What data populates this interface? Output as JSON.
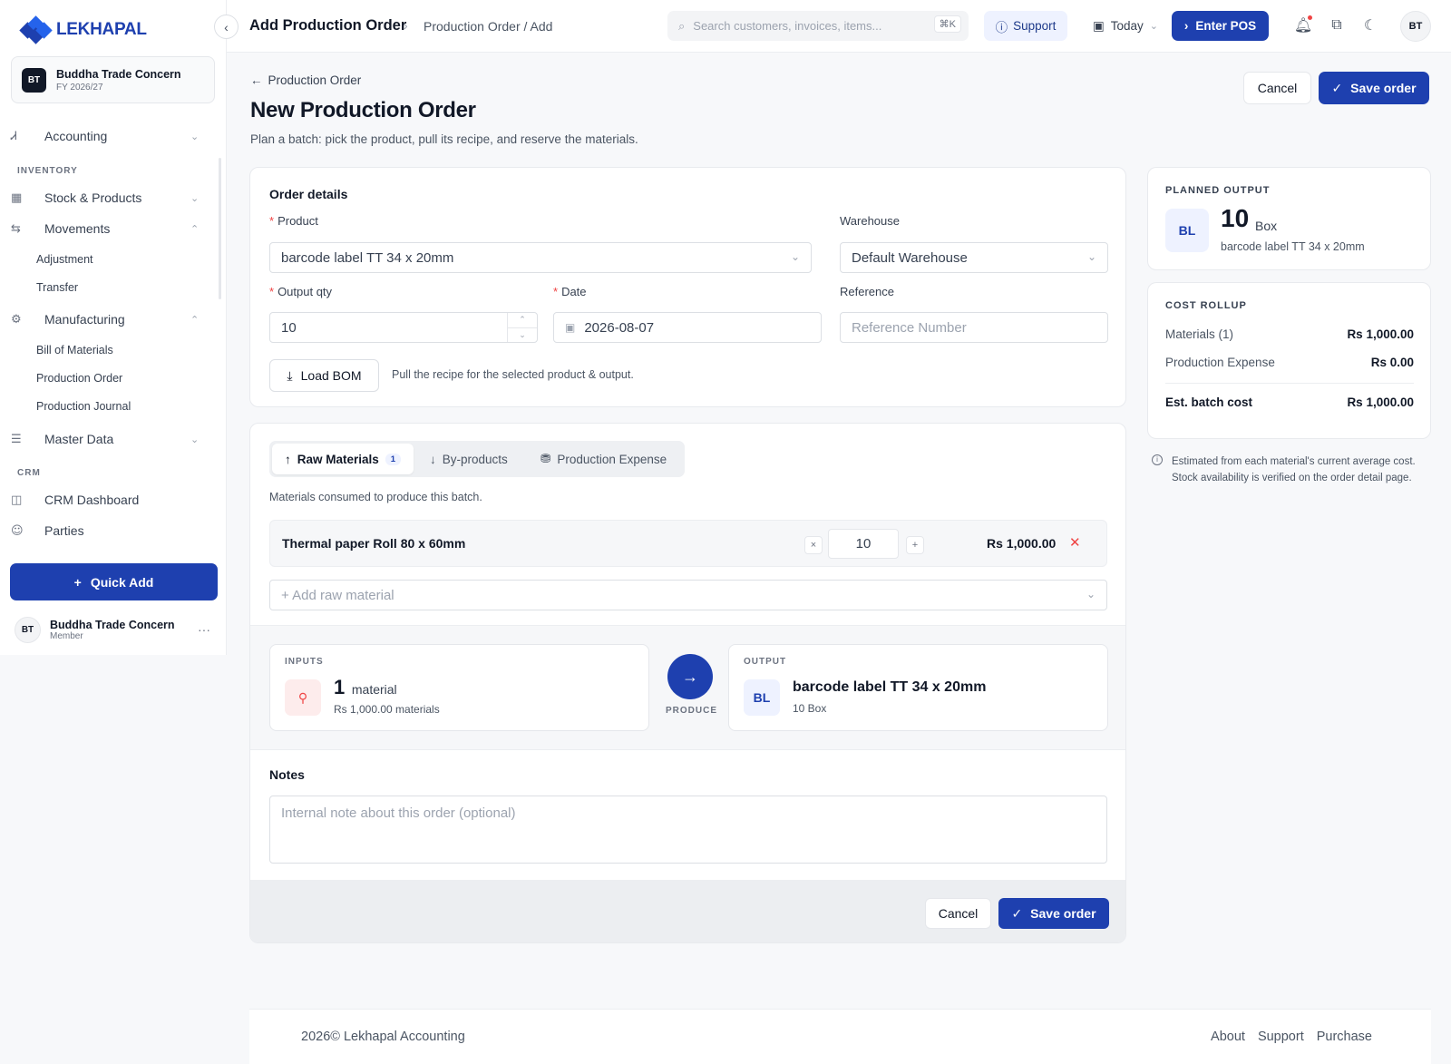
{
  "brand": {
    "name": "LEKHAPAL"
  },
  "org": {
    "initials": "BT",
    "name": "Buddha Trade Concern",
    "fy": "FY 2026/27"
  },
  "nav": {
    "accounting": "Accounting",
    "inventory_section": "INVENTORY",
    "stock": "Stock & Products",
    "movements": "Movements",
    "adjustment": "Adjustment",
    "transfer": "Transfer",
    "manufacturing": "Manufacturing",
    "bom": "Bill of Materials",
    "production_order": "Production Order",
    "production_journal": "Production Journal",
    "master_data": "Master Data",
    "crm_section": "CRM",
    "crm_dashboard": "CRM Dashboard",
    "parties": "Parties"
  },
  "quick_add": "Quick Add",
  "user": {
    "initials": "BT",
    "name": "Buddha Trade Concern",
    "role": "Member"
  },
  "topbar": {
    "title": "Add Production Order",
    "breadcrumb": "Production Order / Add",
    "search_placeholder": "Search customers, invoices, items...",
    "search_kbd": "⌘K",
    "support": "Support",
    "date": "Today",
    "pos": "Enter POS",
    "avatar": "BT"
  },
  "page": {
    "back": "Production Order",
    "title": "New Production Order",
    "subtitle": "Plan a batch: pick the product, pull its recipe, and reserve the materials.",
    "cancel": "Cancel",
    "save": "Save order"
  },
  "order_details": {
    "heading": "Order details",
    "product_label": "Product",
    "product_value": "barcode label TT 34 x 20mm",
    "warehouse_label": "Warehouse",
    "warehouse_value": "Default Warehouse",
    "qty_label": "Output qty",
    "qty_value": "10",
    "date_label": "Date",
    "date_value": "2026-08-07",
    "reference_label": "Reference",
    "reference_placeholder": "Reference Number",
    "load_bom": "Load BOM",
    "load_bom_hint": "Pull the recipe for the selected product & output."
  },
  "materials": {
    "tabs": [
      {
        "label": "Raw Materials",
        "badge": "1"
      },
      {
        "label": "By-products"
      },
      {
        "label": "Production Expense"
      }
    ],
    "description": "Materials consumed to produce this batch.",
    "rows": [
      {
        "name": "Thermal paper Roll 80 x 60mm",
        "qty": "10",
        "amount": "Rs 1,000.00"
      }
    ],
    "add_placeholder": "+ Add raw material"
  },
  "flow": {
    "inputs_label": "INPUTS",
    "inputs_count": "1",
    "inputs_unit": "material",
    "inputs_cost": "Rs 1,000.00 materials",
    "produce_label": "PRODUCE",
    "output_label": "OUTPUT",
    "output_initials": "BL",
    "output_name": "barcode label TT 34 x 20mm",
    "output_qty": "10 Box"
  },
  "notes": {
    "heading": "Notes",
    "placeholder": "Internal note about this order (optional)"
  },
  "planned_output": {
    "heading": "PLANNED OUTPUT",
    "initials": "BL",
    "qty": "10",
    "unit": "Box",
    "product": "barcode label TT 34 x 20mm"
  },
  "cost_rollup": {
    "heading": "COST ROLLUP",
    "materials_label": "Materials (1)",
    "materials_value": "Rs 1,000.00",
    "expense_label": "Production Expense",
    "expense_value": "Rs 0.00",
    "total_label": "Est. batch cost",
    "total_value": "Rs 1,000.00",
    "note": "Estimated from each material's current average cost. Stock availability is verified on the order detail page."
  },
  "footer": {
    "copyright": "2026© Lekhapal Accounting",
    "links": [
      "About",
      "Support",
      "Purchase"
    ]
  },
  "colors": {
    "primary": "#1e40af",
    "danger": "#ef4444"
  }
}
